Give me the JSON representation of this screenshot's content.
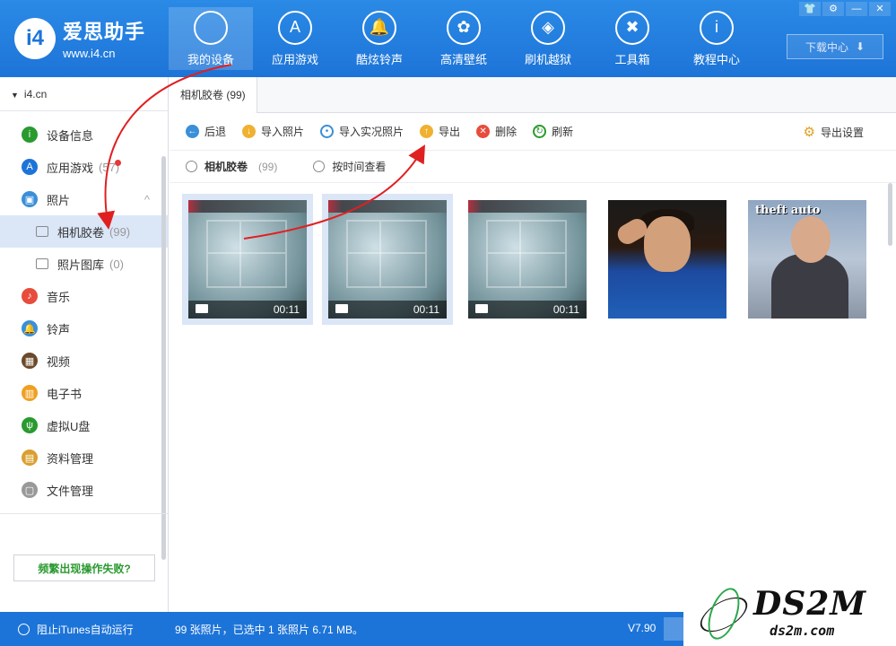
{
  "header": {
    "logo_badge": "i4",
    "logo_name": "爱思助手",
    "logo_url": "www.i4.cn",
    "nav": [
      {
        "label": "我的设备",
        "icon": "apple-icon",
        "glyph": ""
      },
      {
        "label": "应用游戏",
        "icon": "app-store-icon",
        "glyph": "A"
      },
      {
        "label": "酷炫铃声",
        "icon": "bell-icon",
        "glyph": "🔔"
      },
      {
        "label": "高清壁纸",
        "icon": "flower-icon",
        "glyph": "✿"
      },
      {
        "label": "刷机越狱",
        "icon": "dropbox-icon",
        "glyph": "◈"
      },
      {
        "label": "工具箱",
        "icon": "tools-icon",
        "glyph": "✖"
      },
      {
        "label": "教程中心",
        "icon": "info-icon",
        "glyph": "i"
      }
    ],
    "download_label": "下载中心",
    "win_controls": [
      "👕",
      "⚙",
      "—",
      "✕"
    ]
  },
  "sidebar": {
    "device": "i4.cn",
    "items": [
      {
        "label": "设备信息",
        "count": "",
        "color": "#2a9a2f",
        "glyph": "i"
      },
      {
        "label": "应用游戏",
        "count": "(57)",
        "color": "#1d74d8",
        "glyph": "A"
      },
      {
        "label": "照片",
        "count": "",
        "color": "#3a8fd8",
        "glyph": "▣",
        "caret": "^"
      },
      {
        "label": "相机胶卷",
        "count": "(99)",
        "sub": true
      },
      {
        "label": "照片图库",
        "count": "(0)",
        "sub": true
      },
      {
        "label": "音乐",
        "count": "",
        "color": "#e74c3c",
        "glyph": "♪"
      },
      {
        "label": "铃声",
        "count": "",
        "color": "#3a8fd8",
        "glyph": "🔔"
      },
      {
        "label": "视频",
        "count": "",
        "color": "#6b4a2a",
        "glyph": "▦"
      },
      {
        "label": "电子书",
        "count": "",
        "color": "#f0a020",
        "glyph": "▥"
      },
      {
        "label": "虚拟U盘",
        "count": "",
        "color": "#2a9a2f",
        "glyph": "ψ"
      },
      {
        "label": "资料管理",
        "count": "",
        "color": "#d9a030",
        "glyph": "▤"
      },
      {
        "label": "文件管理",
        "count": "",
        "color": "#999999",
        "glyph": "▢"
      }
    ],
    "help_label": "频繁出现操作失败?"
  },
  "main": {
    "tab_label": "相机胶卷 (99)",
    "toolbar": {
      "back": "后退",
      "import_photo": "导入照片",
      "import_live": "导入实况照片",
      "export": "导出",
      "delete": "删除",
      "refresh": "刷新",
      "export_settings": "导出设置"
    },
    "filter": {
      "camera_roll": "相机胶卷",
      "camera_roll_count": "(99)",
      "by_time": "按时间查看"
    },
    "thumbs": [
      {
        "type": "video",
        "duration": "00:11",
        "selected": true
      },
      {
        "type": "video",
        "duration": "00:11",
        "selected": true
      },
      {
        "type": "video",
        "duration": "00:11",
        "selected": false
      },
      {
        "type": "photo",
        "selected": false
      },
      {
        "type": "photo",
        "selected": false,
        "overlay_text": "theft auto"
      }
    ]
  },
  "status": {
    "itunes_label": "阻止iTunes自动运行",
    "info": "99 张照片，已选中 1 张照片 6.71 MB。",
    "version": "V7.90"
  },
  "watermark": {
    "big": "DS2M",
    "small": "ds2m.com"
  }
}
